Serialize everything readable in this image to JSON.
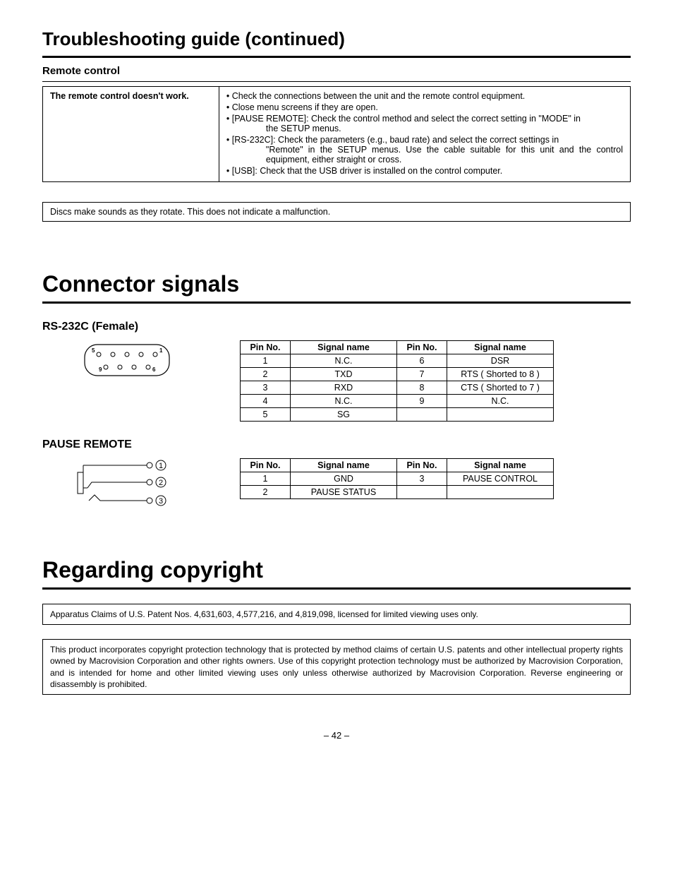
{
  "page_title": "Troubleshooting guide (continued)",
  "remote_control": {
    "heading": "Remote control",
    "symptom": "The remote control doesn't work.",
    "bullets": [
      {
        "lead": "• Check the connections between the unit and the remote control equipment."
      },
      {
        "lead": "• Close menu screens if they are open."
      },
      {
        "lead": "• [PAUSE REMOTE]: Check the control method and select the correct setting in \"MODE\" in",
        "detail": "the SETUP menus."
      },
      {
        "lead": "• [RS-232C]: Check the parameters (e.g., baud rate) and select the correct settings in",
        "detail": "\"Remote\" in the SETUP menus. Use the cable suitable for this unit and the control equipment, either straight or cross."
      },
      {
        "lead": "• [USB]: Check that the USB driver is installed on the control computer."
      }
    ]
  },
  "disc_note": "Discs make sounds as they rotate. This does not indicate a malfunction.",
  "connector": {
    "title": "Connector signals",
    "rs232c": {
      "heading": "RS-232C (Female)",
      "headers": {
        "pin": "Pin No.",
        "signal": "Signal name"
      },
      "rows": [
        {
          "p1": "1",
          "s1": "N.C.",
          "p2": "6",
          "s2": "DSR"
        },
        {
          "p1": "2",
          "s1": "TXD",
          "p2": "7",
          "s2": "RTS ( Shorted to 8 )"
        },
        {
          "p1": "3",
          "s1": "RXD",
          "p2": "8",
          "s2": "CTS ( Shorted to 7 )"
        },
        {
          "p1": "4",
          "s1": "N.C.",
          "p2": "9",
          "s2": "N.C."
        },
        {
          "p1": "5",
          "s1": "SG",
          "p2": "",
          "s2": ""
        }
      ]
    },
    "pause": {
      "heading": "PAUSE REMOTE",
      "headers": {
        "pin": "Pin No.",
        "signal": "Signal name"
      },
      "rows": [
        {
          "p1": "1",
          "s1": "GND",
          "p2": "3",
          "s2": "PAUSE CONTROL"
        },
        {
          "p1": "2",
          "s1": "PAUSE STATUS",
          "p2": "",
          "s2": ""
        }
      ]
    }
  },
  "copyright": {
    "title": "Regarding copyright",
    "box1": "Apparatus Claims of U.S. Patent Nos. 4,631,603, 4,577,216, and 4,819,098, licensed for limited viewing uses only.",
    "box2": "This product incorporates copyright protection technology that is protected by method claims of certain U.S. patents and other intellectual property rights owned by Macrovision Corporation and other rights owners. Use of this copyright protection technology must be authorized by Macrovision Corporation, and is intended for home and other limited viewing uses only unless otherwise authorized by Macrovision Corporation. Reverse engineering or disassembly is prohibited."
  },
  "page_number": "– 42 –"
}
